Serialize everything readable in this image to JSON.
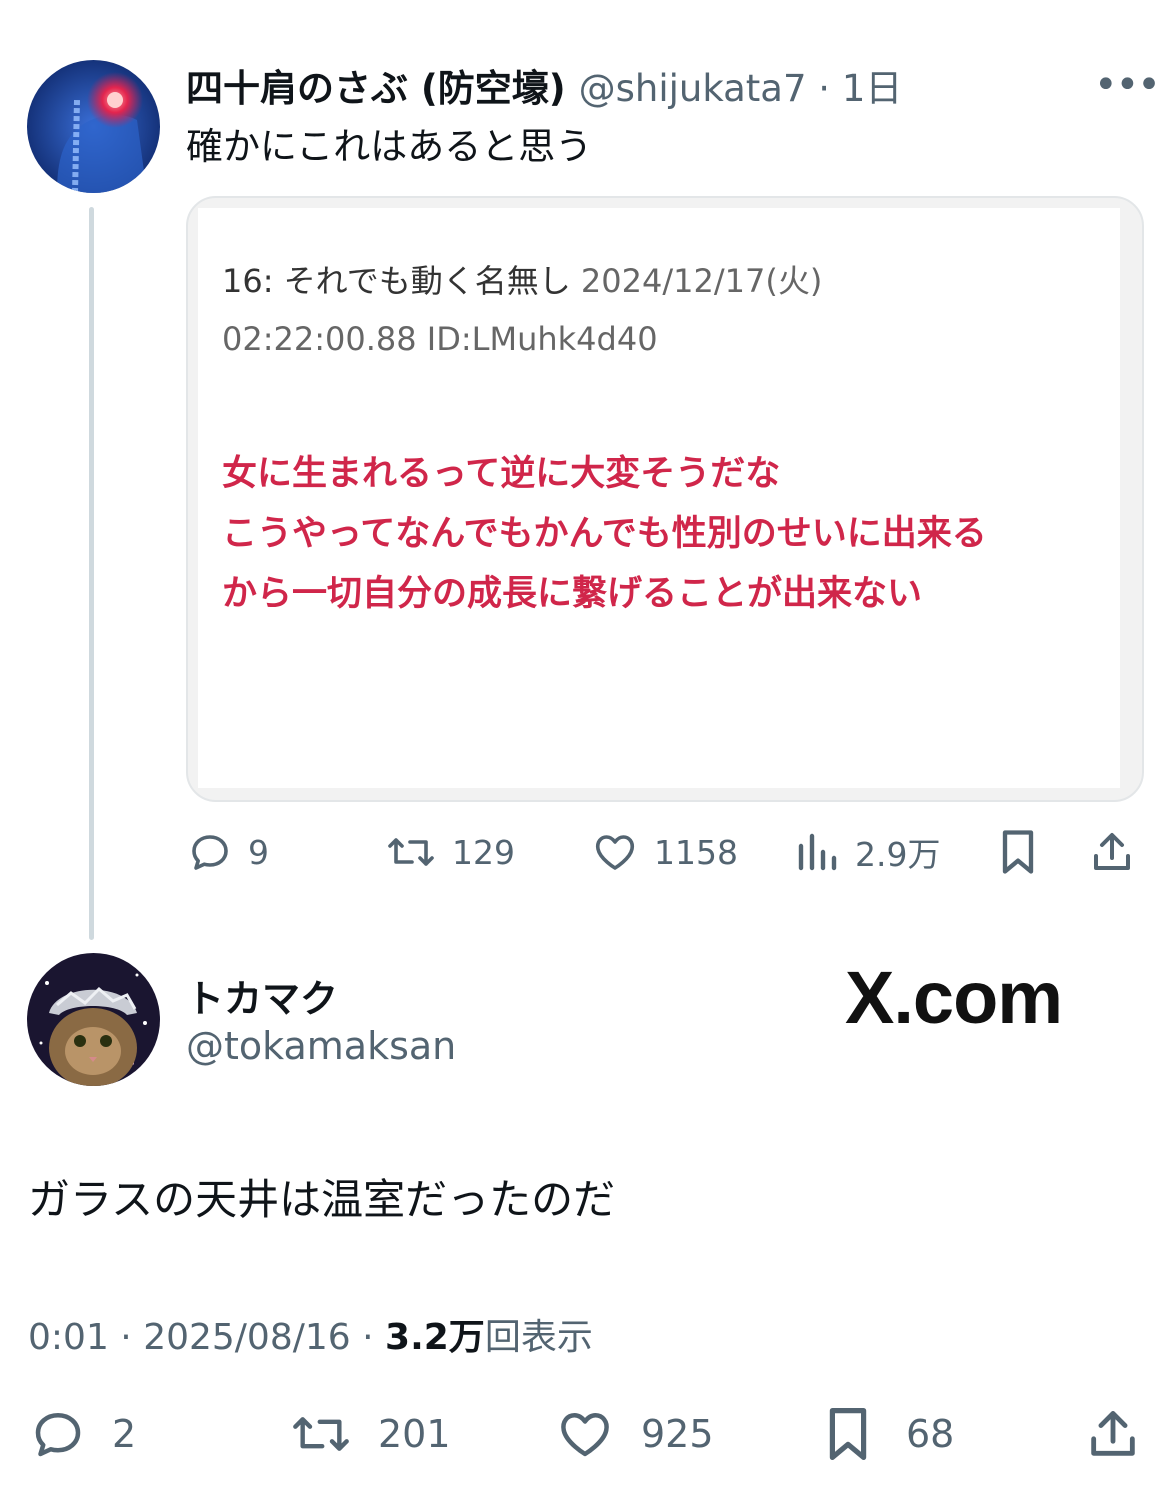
{
  "quoted_tweet": {
    "author_name": "四十肩のさぶ (防空壕)",
    "handle": "@shijukata7",
    "time": "1日",
    "text": "確かにこれはあると思う",
    "image": {
      "post_header": "16: それでも動く名無し",
      "post_date": "2024/12/17(火)",
      "post_meta": "02:22:00.88 ID:LMuhk4d40",
      "body_lines": [
        "女に生まれるって逆に大変そうだな",
        "こうやってなんでもかんでも性別のせいに出来る",
        "から一切自分の成長に繋げることが出来ない"
      ],
      "body_color": "#d0264a"
    },
    "stats": {
      "replies": "9",
      "retweets": "129",
      "likes": "1158",
      "views": "2.9万"
    }
  },
  "main_tweet": {
    "author_name": "トカマク",
    "handle": "@tokamaksan",
    "brand": "X.com",
    "text": "ガラスの天井は温室だったのだ",
    "time": "0:01",
    "date": "2025/08/16",
    "views_count": "3.2万",
    "views_label": "回表示",
    "stats": {
      "replies": "2",
      "retweets": "201",
      "likes": "925",
      "bookmarks": "68"
    }
  },
  "icons": {
    "reply": "reply-icon",
    "retweet": "retweet-icon",
    "like": "heart-icon",
    "views": "views-icon",
    "bookmark": "bookmark-icon",
    "share": "share-icon",
    "more": "more-icon"
  },
  "colors": {
    "muted_text": "#536471",
    "thread_line": "#cfd9de"
  }
}
